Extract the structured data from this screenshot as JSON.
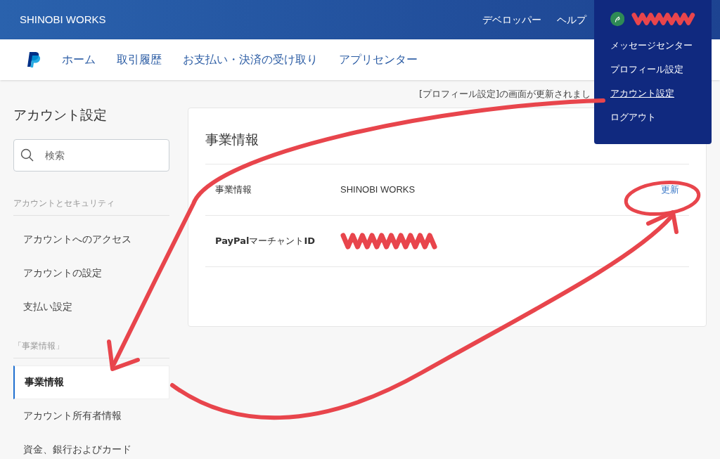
{
  "header": {
    "brand": "SHINOBI WORKS",
    "links": [
      "デベロッパー",
      "ヘルプ"
    ]
  },
  "account_menu": {
    "items": [
      {
        "label": "メッセージセンター",
        "selected": false
      },
      {
        "label": "プロフィール設定",
        "selected": false
      },
      {
        "label": "アカウント設定",
        "selected": true
      },
      {
        "label": "ログアウト",
        "selected": false
      }
    ]
  },
  "nav": {
    "items": [
      "ホーム",
      "取引履歴",
      "お支払い・決済の受け取り",
      "アプリセンター"
    ]
  },
  "notice": "[プロフィール設定]の画面が更新されまし",
  "sidebar": {
    "title": "アカウント設定",
    "search": {
      "placeholder": "検索"
    },
    "sections": [
      {
        "heading": "アカウントとセキュリティ",
        "items": [
          {
            "label": "アカウントへのアクセス",
            "selected": false
          },
          {
            "label": "アカウントの設定",
            "selected": false
          },
          {
            "label": "支払い設定",
            "selected": false
          }
        ]
      },
      {
        "heading": "「事業情報」",
        "items": [
          {
            "label": "事業情報",
            "selected": true
          },
          {
            "label": "アカウント所有者情報",
            "selected": false
          },
          {
            "label": "資金、銀行およびカード",
            "selected": false
          }
        ]
      }
    ]
  },
  "card": {
    "title": "事業情報",
    "rows": [
      {
        "label": "事業情報",
        "value": "SHINOBI WORKS",
        "action": "更新",
        "redacted": false
      },
      {
        "label": "**PayPal**マーチャント**ID**",
        "redacted": true
      }
    ]
  }
}
